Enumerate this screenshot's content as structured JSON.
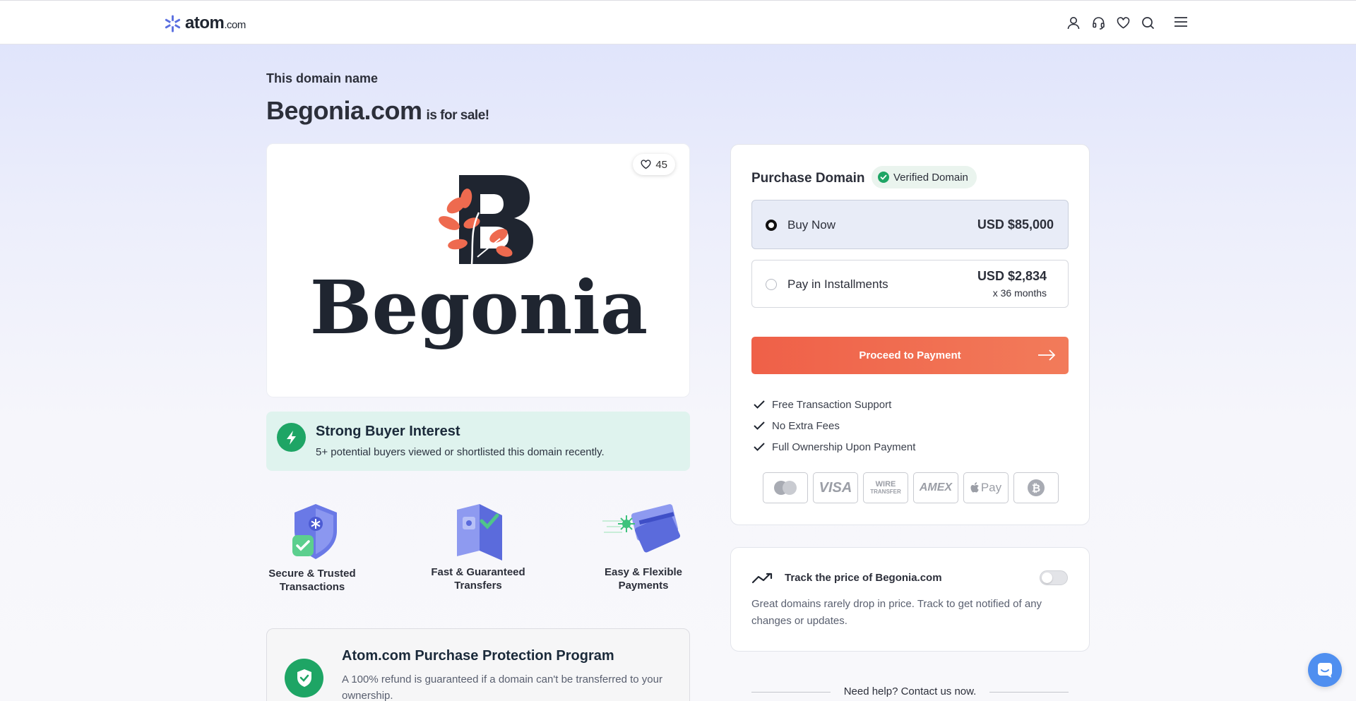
{
  "header": {
    "logo_text": "atom",
    "logo_suffix": ".com",
    "icons": [
      "user-icon",
      "headset-icon",
      "heart-icon",
      "search-icon",
      "menu-icon"
    ]
  },
  "hero": {
    "pre_title": "This domain name",
    "domain": "Begonia.com",
    "for_sale": "is for sale!"
  },
  "logo_card": {
    "likes": "45",
    "brand_word": "Begonia",
    "brand_initial": "B"
  },
  "interest": {
    "title": "Strong Buyer Interest",
    "text": "5+ potential buyers viewed or shortlisted this domain recently."
  },
  "features": [
    {
      "line1": "Secure & Trusted",
      "line2": "Transactions"
    },
    {
      "line1": "Fast & Guaranteed",
      "line2": "Transfers"
    },
    {
      "line1": "Easy & Flexible",
      "line2": "Payments"
    }
  ],
  "protection": {
    "title": "Atom.com Purchase Protection Program",
    "text": "A 100% refund is guaranteed if a domain can't be transferred to your ownership."
  },
  "purchase": {
    "title": "Purchase Domain",
    "verified": "Verified Domain",
    "buy_now_label": "Buy Now",
    "buy_now_price": "USD $85,000",
    "installments_label": "Pay in Installments",
    "installments_price": "USD $2,834",
    "installments_months": "x 36 months",
    "proceed": "Proceed to Payment",
    "checks": [
      "Free Transaction Support",
      "No Extra Fees",
      "Full Ownership Upon Payment"
    ],
    "payment_methods": [
      "mastercard-icon",
      "visa-icon",
      "wire-transfer-icon",
      "amex-icon",
      "apple-pay-icon",
      "bitcoin-icon"
    ],
    "visa": "VISA",
    "wire1": "WIRE",
    "wire2": "TRANSFER",
    "amex": "AMEX",
    "apple_pay": "Pay"
  },
  "track": {
    "title": "Track the price of Begonia.com",
    "text": "Great domains rarely drop in price. Track to get notified of any changes or updates.",
    "enabled": false
  },
  "help": {
    "text": "Need help? Contact us now."
  },
  "colors": {
    "accent": "#f06a4f",
    "success": "#1ea565",
    "brand": "#4a5fd6"
  }
}
